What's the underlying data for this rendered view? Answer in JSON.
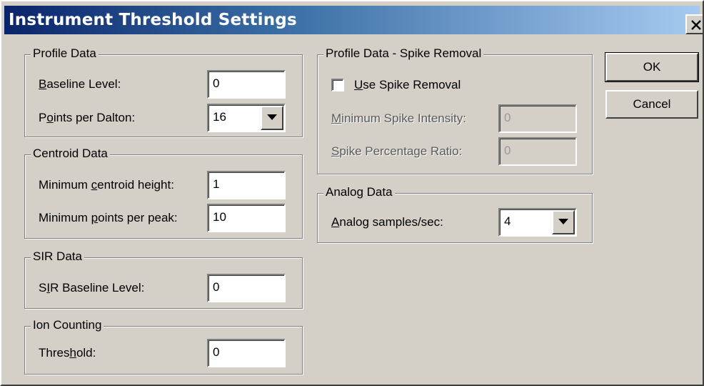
{
  "window": {
    "title": "Instrument Threshold Settings",
    "close_glyph": "×"
  },
  "buttons": {
    "ok": "OK",
    "cancel": "Cancel"
  },
  "profile_data": {
    "legend": "Profile Data",
    "baseline_label": {
      "pre": "",
      "key": "B",
      "post": "aseline Level:"
    },
    "baseline_value": "0",
    "points_label": {
      "pre": "P",
      "key": "o",
      "post": "ints per Dalton:"
    },
    "points_value": "16"
  },
  "centroid_data": {
    "legend": "Centroid Data",
    "min_height_label": {
      "pre": "Minimum ",
      "key": "c",
      "post": "entroid height:"
    },
    "min_height_value": "1",
    "min_points_label": {
      "pre": "Minimum ",
      "key": "p",
      "post": "oints per peak:"
    },
    "min_points_value": "10"
  },
  "sir_data": {
    "legend": "SIR Data",
    "baseline_label": {
      "pre": "S",
      "key": "I",
      "post": "R Baseline Level:"
    },
    "baseline_value": "0"
  },
  "ion_counting": {
    "legend": "Ion Counting",
    "threshold_label": {
      "pre": "Thres",
      "key": "h",
      "post": "old:"
    },
    "threshold_value": "0"
  },
  "spike_removal": {
    "legend": "Profile Data - Spike Removal",
    "use_label": {
      "pre": "",
      "key": "U",
      "post": "se Spike Removal"
    },
    "use_checked": false,
    "min_intensity_label": {
      "pre": "",
      "key": "M",
      "post": "inimum Spike Intensity:"
    },
    "min_intensity_value": "0",
    "ratio_label": {
      "pre": "",
      "key": "S",
      "post": "pike Percentage Ratio:"
    },
    "ratio_value": "0"
  },
  "analog_data": {
    "legend": "Analog Data",
    "samples_label": {
      "pre": "",
      "key": "A",
      "post": "nalog samples/sec:"
    },
    "samples_value": "4"
  }
}
